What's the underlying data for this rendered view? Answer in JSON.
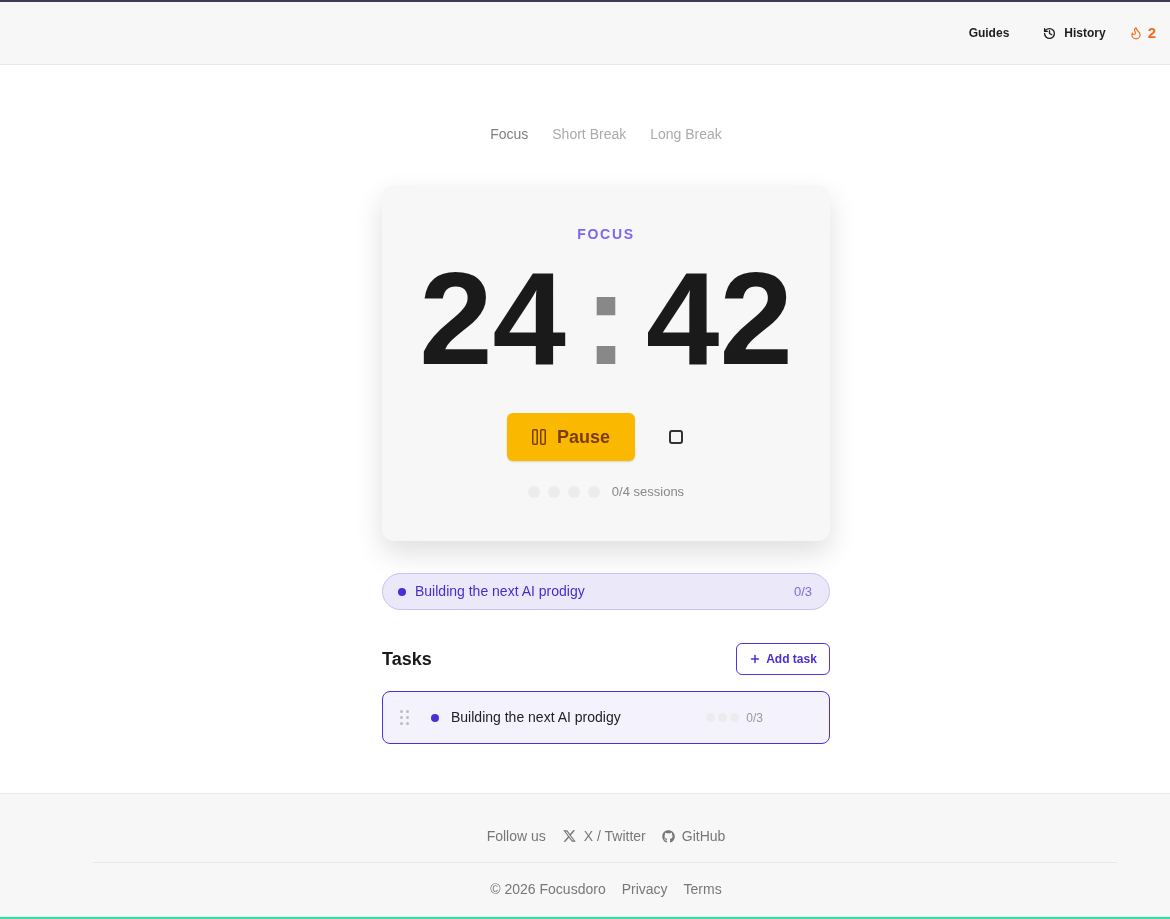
{
  "header": {
    "nav": [
      {
        "kind": "link",
        "label": "Guides"
      },
      {
        "kind": "history",
        "label": "History"
      },
      {
        "kind": "streak",
        "label": "2"
      }
    ]
  },
  "mode_tabs": [
    {
      "label": "Focus",
      "selected": true
    },
    {
      "label": "Short Break",
      "selected": false
    },
    {
      "label": "Long Break",
      "selected": false
    }
  ],
  "timer": {
    "mode_label": "FOCUS",
    "minutes": "24",
    "separator": ":",
    "seconds": "42",
    "primary_button": "Pause",
    "sessions": [
      {
        "completed": false
      },
      {
        "completed": false
      },
      {
        "completed": false
      },
      {
        "completed": false
      }
    ],
    "session_count": "0/4 sessions"
  },
  "active_task": {
    "title": "Building the next AI prodigy",
    "progress": "0/3",
    "completed": false
  },
  "tasks": {
    "heading": "Tasks",
    "add_button": "Add task",
    "items": [
      {
        "title": "Building the next AI prodigy",
        "selected": true,
        "pomodoros": [
          {
            "completed": false
          },
          {
            "completed": false
          },
          {
            "completed": false
          }
        ],
        "progress": "0/3"
      }
    ]
  },
  "footer": {
    "follow_label": "Follow us",
    "social": [
      {
        "kind": "x",
        "label": "X / Twitter"
      },
      {
        "kind": "github",
        "label": "GitHub"
      }
    ],
    "copyright": "© 2026 Focusdoro",
    "links": [
      "Privacy",
      "Terms"
    ]
  }
}
